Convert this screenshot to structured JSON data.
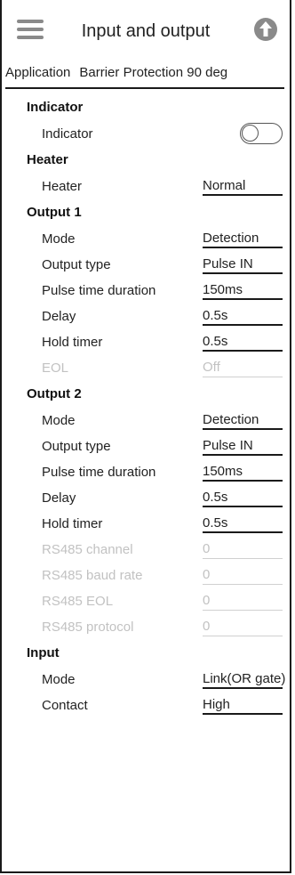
{
  "header": {
    "title": "Input and output",
    "menu_icon": "hamburger-menu-icon",
    "upload_icon": "upload-arrow-icon"
  },
  "application": {
    "label": "Application",
    "value": "Barrier Protection 90 deg"
  },
  "indicator": {
    "heading": "Indicator",
    "label": "Indicator",
    "toggle_on": false
  },
  "heater": {
    "heading": "Heater",
    "label": "Heater",
    "value": "Normal"
  },
  "output1": {
    "heading": "Output 1",
    "mode": {
      "label": "Mode",
      "value": "Detection"
    },
    "output_type": {
      "label": "Output type",
      "value": "Pulse IN"
    },
    "pulse_duration": {
      "label": "Pulse time duration",
      "value": "150ms"
    },
    "delay": {
      "label": "Delay",
      "value": "0.5s"
    },
    "hold_timer": {
      "label": "Hold timer",
      "value": "0.5s"
    },
    "eol": {
      "label": "EOL",
      "value": "Off"
    }
  },
  "output2": {
    "heading": "Output 2",
    "mode": {
      "label": "Mode",
      "value": "Detection"
    },
    "output_type": {
      "label": "Output type",
      "value": "Pulse IN"
    },
    "pulse_duration": {
      "label": "Pulse time duration",
      "value": "150ms"
    },
    "delay": {
      "label": "Delay",
      "value": "0.5s"
    },
    "hold_timer": {
      "label": "Hold timer",
      "value": "0.5s"
    },
    "rs485_channel": {
      "label": "RS485 channel",
      "value": "0"
    },
    "rs485_baud": {
      "label": "RS485 baud rate",
      "value": "0"
    },
    "rs485_eol": {
      "label": "RS485 EOL",
      "value": "0"
    },
    "rs485_protocol": {
      "label": "RS485 protocol",
      "value": "0"
    }
  },
  "input": {
    "heading": "Input",
    "mode": {
      "label": "Mode",
      "value": "Link(OR gate)"
    },
    "contact": {
      "label": "Contact",
      "value": "High"
    }
  }
}
